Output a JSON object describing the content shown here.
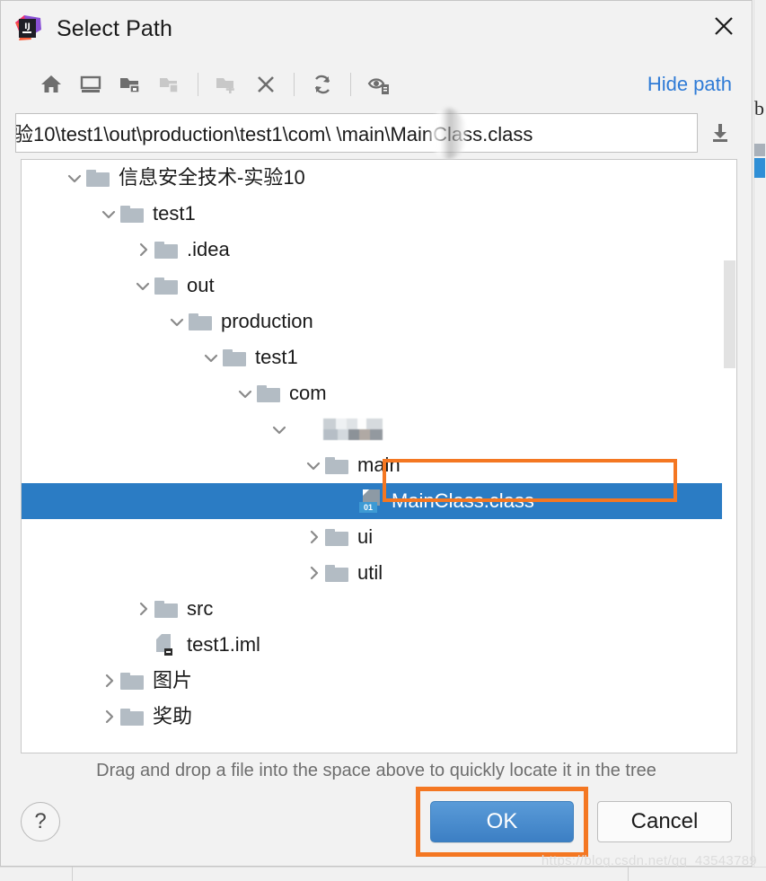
{
  "window": {
    "title": "Select Path",
    "logo_icon": "intellij-idea-logo",
    "close_icon": "close-icon"
  },
  "toolbar": {
    "buttons": [
      {
        "name": "home-icon",
        "tooltip": "Home",
        "disabled": false
      },
      {
        "name": "desktop-icon",
        "tooltip": "Desktop",
        "disabled": false
      },
      {
        "name": "project-folder-icon",
        "tooltip": "Project Folder",
        "disabled": false
      },
      {
        "name": "module-folder-icon",
        "tooltip": "Module Folder",
        "disabled": true
      }
    ],
    "buttons2": [
      {
        "name": "new-folder-icon",
        "tooltip": "New Folder",
        "disabled": true
      },
      {
        "name": "delete-icon",
        "tooltip": "Delete",
        "disabled": false
      }
    ],
    "buttons3": [
      {
        "name": "refresh-icon",
        "tooltip": "Refresh",
        "disabled": false
      }
    ],
    "buttons4": [
      {
        "name": "show-hidden-files-icon",
        "tooltip": "Show Hidden Files",
        "disabled": false
      }
    ],
    "hide_path_label": "Hide path"
  },
  "path": {
    "value": "验10\\test1\\out\\production\\test1\\com\\      \\main\\MainClass.class",
    "placeholder": "",
    "download_icon": "download-arrow-icon",
    "has_blur_mask": true
  },
  "tree": {
    "rows": [
      {
        "label": "信息安全技术-实验10",
        "indent": 1,
        "arrow": "expanded",
        "icon": "folder-icon",
        "selected": false
      },
      {
        "label": "test1",
        "indent": 2,
        "arrow": "expanded",
        "icon": "folder-icon",
        "selected": false
      },
      {
        "label": ".idea",
        "indent": 3,
        "arrow": "collapsed",
        "icon": "folder-icon",
        "selected": false
      },
      {
        "label": "out",
        "indent": 3,
        "arrow": "expanded",
        "icon": "folder-icon",
        "selected": false
      },
      {
        "label": "production",
        "indent": 4,
        "arrow": "expanded",
        "icon": "folder-icon",
        "selected": false
      },
      {
        "label": "test1",
        "indent": 5,
        "arrow": "expanded",
        "icon": "folder-icon",
        "selected": false
      },
      {
        "label": "com",
        "indent": 6,
        "arrow": "expanded",
        "icon": "folder-icon",
        "selected": false
      },
      {
        "label": "",
        "indent": 7,
        "arrow": "expanded",
        "icon": "redacted-folder-icon",
        "selected": false,
        "redacted": true
      },
      {
        "label": "main",
        "indent": 8,
        "arrow": "expanded",
        "icon": "folder-icon",
        "selected": false
      },
      {
        "label": "MainClass.class",
        "indent": 9,
        "arrow": "none",
        "icon": "class-file-icon",
        "selected": true
      },
      {
        "label": "ui",
        "indent": 8,
        "arrow": "collapsed",
        "icon": "folder-icon",
        "selected": false
      },
      {
        "label": "util",
        "indent": 8,
        "arrow": "collapsed",
        "icon": "folder-icon",
        "selected": false
      },
      {
        "label": "src",
        "indent": 3,
        "arrow": "collapsed",
        "icon": "folder-icon",
        "selected": false
      },
      {
        "label": "test1.iml",
        "indent": 3,
        "arrow": "none",
        "icon": "iml-file-icon",
        "selected": false
      },
      {
        "label": "图片",
        "indent": 2,
        "arrow": "collapsed",
        "icon": "folder-icon",
        "selected": false
      },
      {
        "label": "奖助",
        "indent": 2,
        "arrow": "collapsed",
        "icon": "folder-icon",
        "selected": false
      }
    ],
    "class_icon_badge": "01",
    "scrollbar": {
      "name": "tree-vertical-scrollbar"
    }
  },
  "hint": "Drag and drop a file into the space above to quickly locate it in the tree",
  "footer": {
    "help_label": "?",
    "ok_label": "OK",
    "cancel_label": "Cancel"
  },
  "annotations": {
    "highlight_color": "#f47722",
    "selected_row_box": true,
    "ok_button_box": true
  },
  "background": {
    "editor_letter": "b",
    "watermark": "https://blog.csdn.net/qq_43543789"
  },
  "colors": {
    "selection_blue": "#2b7cc4",
    "accent_link": "#2f7bd6",
    "annotation_orange": "#f47722",
    "dialog_bg": "#f2f2f2",
    "folder_gray": "#b3bcc4"
  }
}
